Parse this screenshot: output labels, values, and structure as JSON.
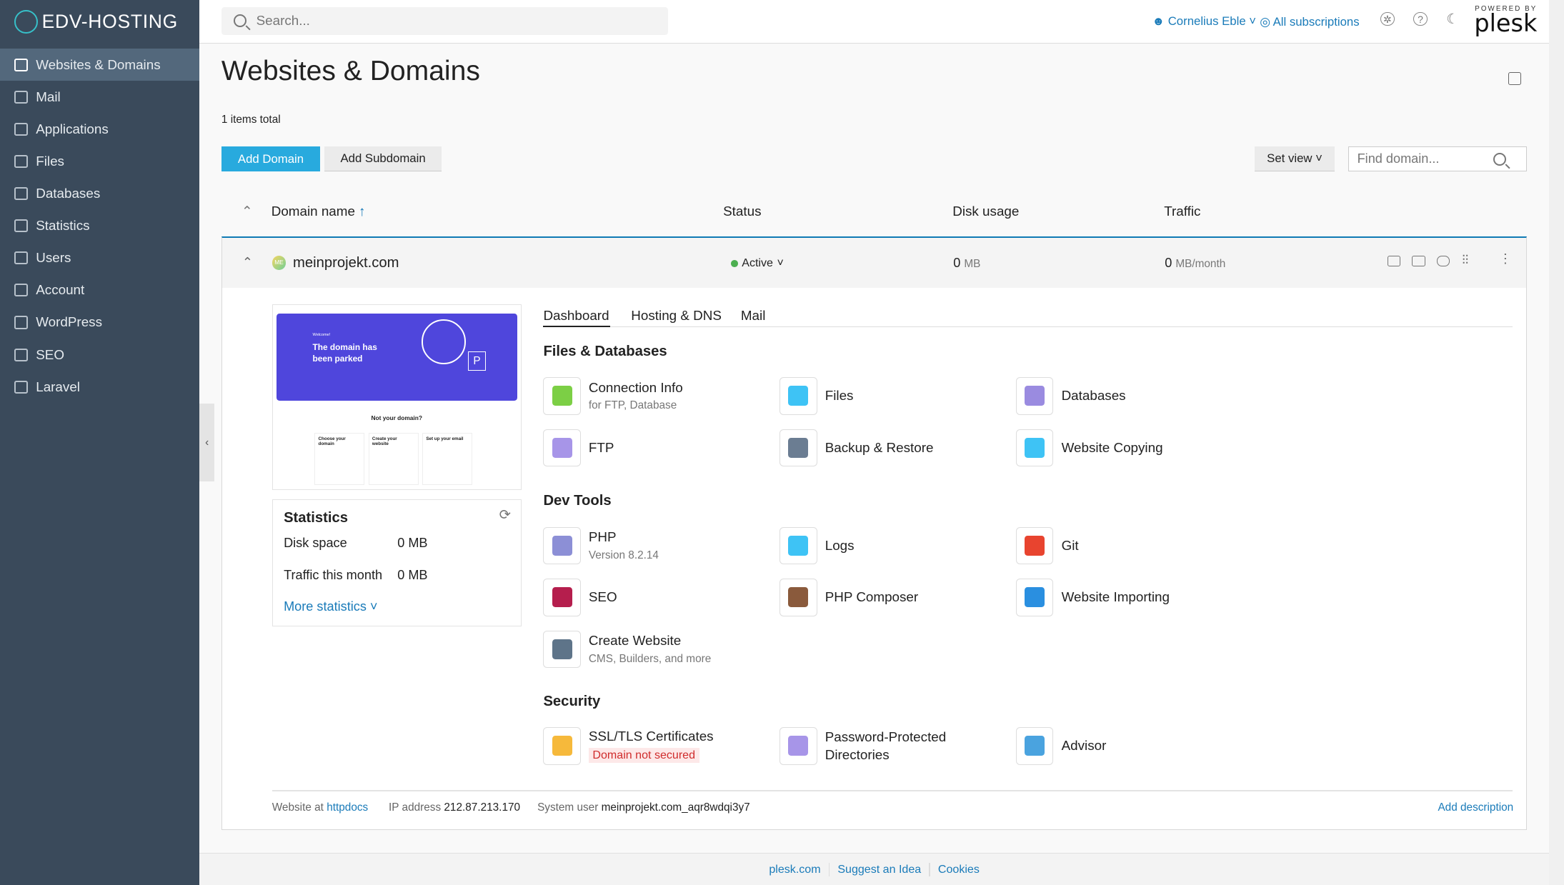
{
  "brand": "EDV-HOSTING",
  "sidebar": {
    "items": [
      {
        "label": "Websites & Domains",
        "icon": "monitor-icon",
        "active": true
      },
      {
        "label": "Mail",
        "icon": "mail-icon"
      },
      {
        "label": "Applications",
        "icon": "gear-icon"
      },
      {
        "label": "Files",
        "icon": "file-icon"
      },
      {
        "label": "Databases",
        "icon": "database-icon"
      },
      {
        "label": "Statistics",
        "icon": "chart-icon"
      },
      {
        "label": "Users",
        "icon": "user-icon"
      },
      {
        "label": "Account",
        "icon": "account-icon"
      },
      {
        "label": "WordPress",
        "icon": "wordpress-icon"
      },
      {
        "label": "SEO",
        "icon": "seo-icon"
      },
      {
        "label": "Laravel",
        "icon": "laravel-icon"
      }
    ],
    "collapse": "‹"
  },
  "topbar": {
    "search_placeholder": "Search...",
    "user": "Cornelius Eble",
    "subscriptions": "All subscriptions",
    "help": "?",
    "powered_by": "POWERED BY",
    "plesk": "plesk"
  },
  "page": {
    "title": "Websites & Domains",
    "count": "1 items total",
    "add_domain": "Add Domain",
    "add_subdomain": "Add Subdomain",
    "set_view": "Set view",
    "find_placeholder": "Find domain..."
  },
  "table": {
    "headers": {
      "name": "Domain name",
      "sort": "↑",
      "status": "Status",
      "disk": "Disk usage",
      "traffic": "Traffic"
    }
  },
  "domain": {
    "name": "meinprojekt.com",
    "avatar": "ME",
    "status": "Active",
    "status_color": "#4caf50",
    "disk_value": "0",
    "disk_unit": "MB",
    "traffic_value": "0",
    "traffic_unit": "MB/month"
  },
  "preview": {
    "welcome": "Welcome!",
    "headline": "The domain has been parked",
    "not_yours": "Not your domain?",
    "cards": [
      "Choose your domain",
      "Create your website",
      "Set up your email"
    ]
  },
  "stats": {
    "title": "Statistics",
    "disk_label": "Disk space",
    "disk_value": "0 MB",
    "traffic_label": "Traffic this month",
    "traffic_value": "0 MB",
    "more": "More statistics"
  },
  "tabs": [
    {
      "label": "Dashboard",
      "active": true
    },
    {
      "label": "Hosting & DNS"
    },
    {
      "label": "Mail"
    }
  ],
  "sections": [
    {
      "title": "Files & Databases",
      "tools": [
        {
          "name": "Connection Info",
          "sub": "for FTP, Database",
          "color": "#7ccf45"
        },
        {
          "name": "Files",
          "color": "#3ec3f5"
        },
        {
          "name": "Databases",
          "color": "#9a8be0"
        },
        {
          "name": "FTP",
          "color": "#a795e8"
        },
        {
          "name": "Backup & Restore",
          "color": "#6b7d92"
        },
        {
          "name": "Website Copying",
          "color": "#3ec3f5"
        }
      ]
    },
    {
      "title": "Dev Tools",
      "tools": [
        {
          "name": "PHP",
          "sub": "Version 8.2.14",
          "color": "#8c8fd6"
        },
        {
          "name": "Logs",
          "color": "#3ec3f5"
        },
        {
          "name": "Git",
          "color": "#e8442f"
        },
        {
          "name": "SEO",
          "color": "#b51e4d"
        },
        {
          "name": "PHP Composer",
          "color": "#8a5a3c"
        },
        {
          "name": "Website Importing",
          "color": "#2a8fe0"
        },
        {
          "name": "Create Website",
          "sub": "CMS, Builders, and more",
          "color": "#5e7489"
        }
      ]
    },
    {
      "title": "Security",
      "tools": [
        {
          "name": "SSL/TLS Certificates",
          "badge": "Domain not secured",
          "color": "#f6b93b"
        },
        {
          "name": "Password-Protected Directories",
          "color": "#a795e8"
        },
        {
          "name": "Advisor",
          "color": "#4aa3df"
        }
      ]
    }
  ],
  "info": {
    "website_at": "Website at",
    "httpdocs": "httpdocs",
    "ip_label": "IP address",
    "ip": "212.87.213.170",
    "user_label": "System user",
    "user": "meinprojekt.com_aqr8wdqi3y7",
    "add_description": "Add description"
  },
  "footer": {
    "links": [
      "plesk.com",
      "Suggest an Idea",
      "Cookies"
    ]
  }
}
